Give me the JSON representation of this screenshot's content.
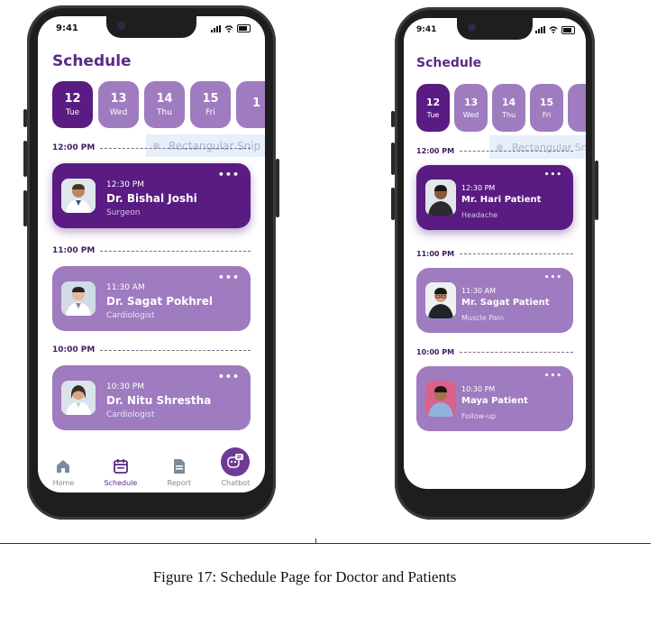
{
  "status_bar": {
    "time": "9:41"
  },
  "left_phone": {
    "title": "Schedule",
    "days": [
      {
        "num": "12",
        "day": "Tue"
      },
      {
        "num": "13",
        "day": "Wed"
      },
      {
        "num": "14",
        "day": "Thu"
      },
      {
        "num": "15",
        "day": "Fri"
      },
      {
        "num": "1",
        "day": ""
      }
    ],
    "ghost_label": "Rectangular Snip",
    "sections": [
      {
        "label": "12:00 PM",
        "time": "12:30 PM",
        "name": "Dr. Bishal Joshi",
        "sub": "Surgeon"
      },
      {
        "label": "11:00 PM",
        "time": "11:30 AM",
        "name": "Dr. Sagat Pokhrel",
        "sub": "Cardiologist"
      },
      {
        "label": "10:00 PM",
        "time": "10:30 PM",
        "name": "Dr. Nitu Shrestha",
        "sub": "Cardiologist"
      }
    ],
    "more": "•••",
    "nav": {
      "home": "Home",
      "schedule": "Schedule",
      "report": "Report",
      "chatbot": "Chatbot"
    }
  },
  "right_phone": {
    "title": "Schedule",
    "days": [
      {
        "num": "12",
        "day": "Tue"
      },
      {
        "num": "13",
        "day": "Wed"
      },
      {
        "num": "14",
        "day": "Thu"
      },
      {
        "num": "15",
        "day": "Fri"
      },
      {
        "num": "",
        "day": ""
      }
    ],
    "ghost_label": "Rectangular Snip",
    "sections": [
      {
        "label": "12:00 PM",
        "time": "12:30 PM",
        "name": "Mr. Hari Patient",
        "sub": "Headache"
      },
      {
        "label": "11:00 PM",
        "time": "11:30 AM",
        "name": "Mr. Sagat Patient",
        "sub": "Muscle Pain"
      },
      {
        "label": "10:00 PM",
        "time": "10:30 PM",
        "name": "Maya Patient",
        "sub": "Follow-up"
      }
    ],
    "more": "•••"
  },
  "caption": "Figure 17: Schedule Page for Doctor and Patients",
  "colors": {
    "primary_dark": "#5a1b82",
    "primary_light": "#9f7bc0",
    "title": "#5b2a86"
  }
}
